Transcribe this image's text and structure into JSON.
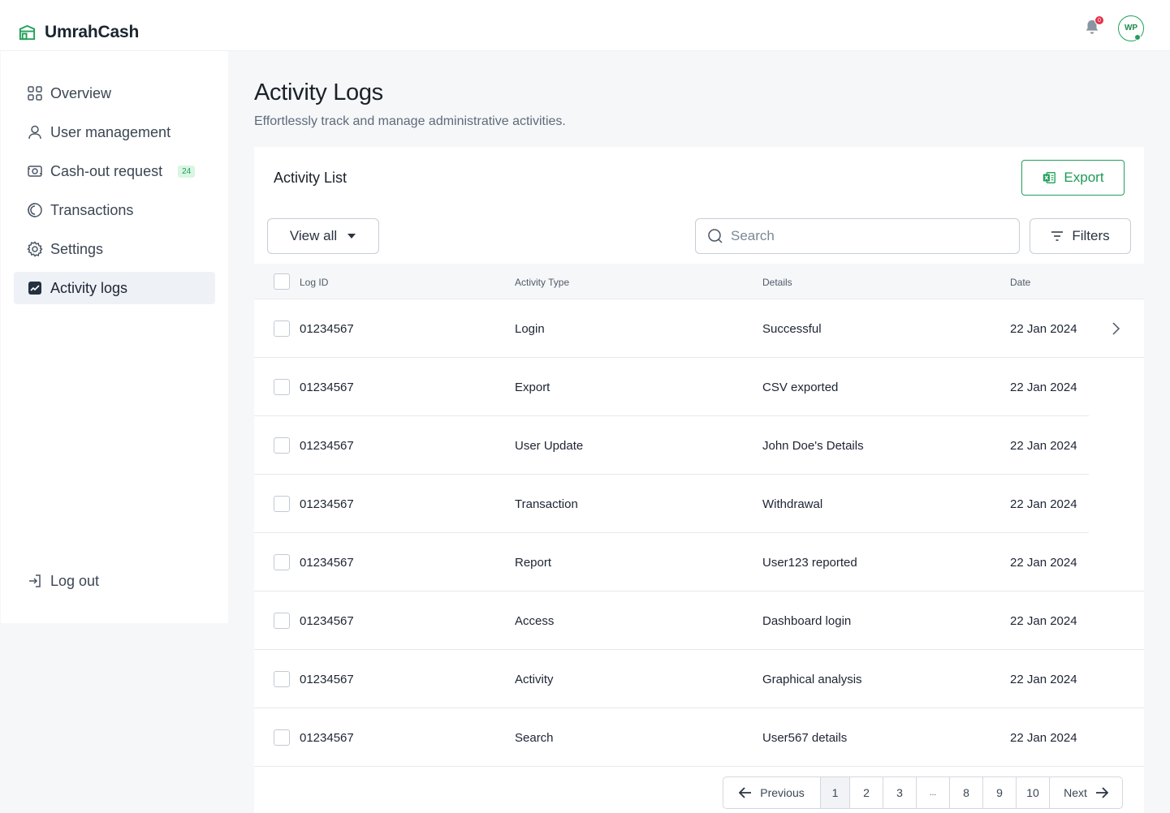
{
  "app": {
    "name": "UmrahCash"
  },
  "header": {
    "notification_count": "0",
    "avatar_initials": "WP"
  },
  "sidebar": {
    "items": [
      {
        "label": "Overview",
        "icon": "grid-icon"
      },
      {
        "label": "User management",
        "icon": "user-icon"
      },
      {
        "label": "Cash-out request",
        "icon": "cash-icon",
        "badge": "24"
      },
      {
        "label": "Transactions",
        "icon": "transactions-icon"
      },
      {
        "label": "Settings",
        "icon": "settings-icon"
      },
      {
        "label": "Activity logs",
        "icon": "activity-icon",
        "active": true
      }
    ],
    "logout_label": "Log out"
  },
  "page": {
    "title": "Activity Logs",
    "subtitle": "Effortlessly track and manage administrative activities."
  },
  "card": {
    "title": "Activity List",
    "export_label": "Export",
    "view_all_label": "View all",
    "search_placeholder": "Search",
    "filters_label": "Filters"
  },
  "table": {
    "columns": [
      "Log ID",
      "Activity Type",
      "Details",
      "Date"
    ],
    "rows": [
      {
        "log_id": "01234567",
        "activity_type": "Login",
        "details": "Successful",
        "date": "22 Jan 2024"
      },
      {
        "log_id": "01234567",
        "activity_type": "Export",
        "details": "CSV exported",
        "date": "22 Jan 2024"
      },
      {
        "log_id": "01234567",
        "activity_type": "User Update",
        "details": "John Doe's Details",
        "date": "22 Jan 2024"
      },
      {
        "log_id": "01234567",
        "activity_type": "Transaction",
        "details": "Withdrawal",
        "date": "22 Jan 2024"
      },
      {
        "log_id": "01234567",
        "activity_type": "Report",
        "details": "User123 reported",
        "date": "22 Jan 2024"
      },
      {
        "log_id": "01234567",
        "activity_type": "Access",
        "details": "Dashboard login",
        "date": "22 Jan 2024"
      },
      {
        "log_id": "01234567",
        "activity_type": "Activity",
        "details": "Graphical analysis",
        "date": "22 Jan 2024"
      },
      {
        "log_id": "01234567",
        "activity_type": "Search",
        "details": "User567 details",
        "date": "22 Jan 2024"
      }
    ]
  },
  "pagination": {
    "previous_label": "Previous",
    "next_label": "Next",
    "pages": [
      "1",
      "2",
      "3",
      "...",
      "8",
      "9",
      "10"
    ],
    "current": "1"
  },
  "colors": {
    "accent": "#22a05a",
    "badge_red": "#e5304a"
  }
}
